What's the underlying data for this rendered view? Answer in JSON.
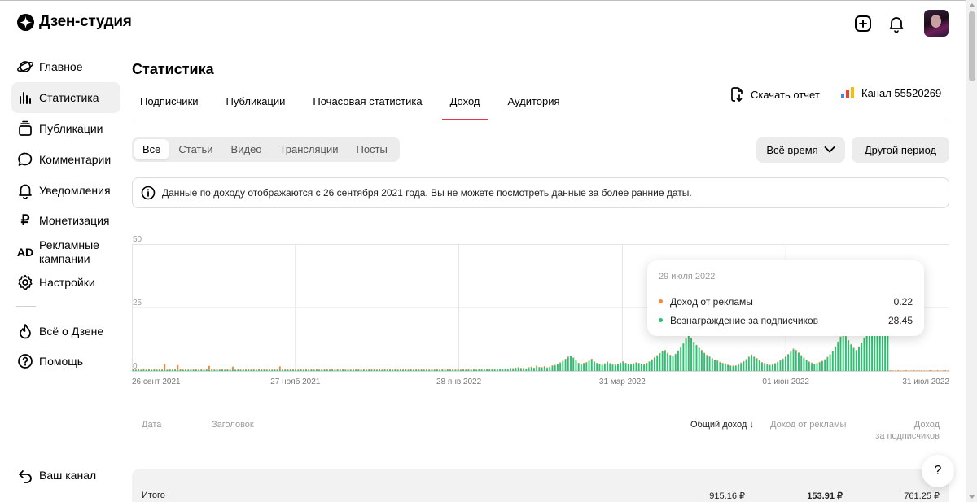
{
  "app": {
    "title": "Дзен-студия"
  },
  "header": {
    "add_icon": "plus-square-icon",
    "bell_icon": "bell-icon",
    "avatar_icon": "avatar-image"
  },
  "sidebar": {
    "items": [
      {
        "label": "Главное",
        "icon": "planet-icon"
      },
      {
        "label": "Статистика",
        "icon": "bar-chart-icon",
        "active": true
      },
      {
        "label": "Публикации",
        "icon": "stack-icon"
      },
      {
        "label": "Комментарии",
        "icon": "comment-icon"
      },
      {
        "label": "Уведомления",
        "icon": "bell-icon"
      },
      {
        "label": "Монетизация",
        "icon": "ruble-icon"
      },
      {
        "label": "Рекламные кампании",
        "icon": "ad-icon"
      },
      {
        "label": "Настройки",
        "icon": "gear-icon"
      },
      {
        "label": "Всё о Дзене",
        "icon": "fire-icon"
      },
      {
        "label": "Помощь",
        "icon": "question-icon"
      }
    ],
    "bottom": {
      "label": "Ваш канал",
      "icon": "back-arrow-icon"
    }
  },
  "main": {
    "title": "Статистика",
    "tabs": [
      "Подписчики",
      "Публикации",
      "Почасовая статистика",
      "Доход",
      "Аудитория"
    ],
    "active_tab": "Доход",
    "download_label": "Скачать отчет",
    "channel_label": "Канал 55520269",
    "content_filters": [
      "Все",
      "Статьи",
      "Видео",
      "Трансляции",
      "Посты"
    ],
    "active_filter": "Все",
    "period_selected": "Всё время",
    "other_period": "Другой период",
    "notice": "Данные по доходу отображаются с 26 сентября 2021 года. Вы не можете посмотреть данные за более ранние даты."
  },
  "tooltip": {
    "date": "29 июля 2022",
    "rows": [
      {
        "label": "Доход от рекламы",
        "value": "0.22"
      },
      {
        "label": "Вознаграждение за подписчиков",
        "value": "28.45"
      }
    ]
  },
  "table": {
    "headers": {
      "date": "Дата",
      "title": "Заголовок",
      "total": "Общий доход",
      "ads": "Доход от рекламы",
      "subs_line1": "Доход",
      "subs_line2": "за подписчиков"
    },
    "total_row": {
      "label": "Итого",
      "total": "915.16 ₽",
      "ads": "153.91 ₽",
      "subs": "761.25 ₽"
    }
  },
  "help_label": "?",
  "colors": {
    "ads": "#f28a3c",
    "subs": "#2fbf71",
    "active_tab": "#e8334a"
  },
  "chart_data": {
    "type": "bar",
    "stacked": true,
    "ylim": [
      0,
      50
    ],
    "y_ticks": [
      "0",
      "25",
      "50"
    ],
    "x_tick_labels": [
      "26 сент 2021",
      "27 нояб 2021",
      "28 янв 2022",
      "31 мар 2022",
      "01 июн 2022",
      "31 июл 2022"
    ],
    "x_start": "2021-09-26",
    "x_end": "2022-07-31",
    "grid": true,
    "series": [
      {
        "name": "Доход от рекламы",
        "color": "#f28a3c",
        "values": [
          0.4,
          0.2,
          0.3,
          0.2,
          0.5,
          0.2,
          0.3,
          0.2,
          0.3,
          0.2,
          0.2,
          0.3,
          2.1,
          0.2,
          0.3,
          0.2,
          0.4,
          1.9,
          0.3,
          0.2,
          0.3,
          0.2,
          0.2,
          0.3,
          0.2,
          0.2,
          0.3,
          0.2,
          0.2,
          1.6,
          0.2,
          0.3,
          0.2,
          0.2,
          0.3,
          0.2,
          0.2,
          0.3,
          1.2,
          0.2,
          0.3,
          0.2,
          0.2,
          0.3,
          0.2,
          0.2,
          0.3,
          0.2,
          0.2,
          0.3,
          0.2,
          0.2,
          0.3,
          0.2,
          0.2,
          0.3,
          1.3,
          0.2,
          0.3,
          0.2,
          0.2,
          0.3,
          0.2,
          0.2,
          0.3,
          0.2,
          0.2,
          0.3,
          0.2,
          0.2,
          0.3,
          0.2,
          0.2,
          0.3,
          0.2,
          0.2,
          0.3,
          0.2,
          0.2,
          0.3,
          0.2,
          0.2,
          0.3,
          0.2,
          0.2,
          0.3,
          0.2,
          0.2,
          0.3,
          0.2,
          0.2,
          0.3,
          0.2,
          0.2,
          0.3,
          0.2,
          0.2,
          0.3,
          0.2,
          0.2,
          0.3,
          0.2,
          0.2,
          0.3,
          0.2,
          0.2,
          0.3,
          0.2,
          0.2,
          0.3,
          0.2,
          0.2,
          0.3,
          0.2,
          0.2,
          0.3,
          0.2,
          0.2,
          0.3,
          0.2,
          0.2,
          0.3,
          0.2,
          0.2,
          0.3,
          0.2,
          0.2,
          0.3,
          0.2,
          0.2,
          0.3,
          0.2,
          0.2,
          0.3,
          0.2,
          0.2,
          0.3,
          0.2,
          0.2,
          0.3,
          0.2,
          0.2,
          0.3,
          0.2,
          0.2,
          0.3,
          0.2,
          0.2,
          0.3,
          0.2,
          0.2,
          0.3,
          0.2,
          0.2,
          0.3,
          0.2,
          0.2,
          0.3,
          0.2,
          0.2,
          0.3,
          0.2,
          0.2,
          0.3,
          0.2,
          0.2,
          0.3,
          0.2,
          0.2,
          0.3,
          0.2,
          0.2,
          0.3,
          0.2,
          0.2,
          0.3,
          0.2,
          0.2,
          0.3,
          0.2,
          0.2,
          0.3,
          0.2,
          0.2,
          0.3,
          0.2,
          0.2,
          0.3,
          0.2,
          0.2,
          0.3,
          0.2,
          0.2,
          0.3,
          0.2,
          0.2,
          0.3,
          0.2,
          0.2,
          0.3,
          0.2,
          0.2,
          0.3,
          0.2,
          0.2,
          0.3,
          0.2,
          0.2,
          0.3,
          0.2,
          0.2,
          0.3,
          0.2,
          0.2,
          0.3,
          0.2,
          0.2,
          0.3,
          0.2,
          0.2,
          0.3,
          0.2,
          0.2,
          0.3,
          0.2,
          0.2,
          0.3,
          0.2,
          0.2,
          0.3,
          0.2,
          0.2,
          0.3,
          0.2,
          0.2,
          0.3,
          0.2,
          0.2,
          0.3,
          0.2,
          0.2,
          0.3,
          0.2,
          0.2,
          0.3,
          0.2,
          0.2,
          0.3,
          0.2,
          0.2,
          0.3,
          0.2,
          0.2,
          0.3,
          0.2,
          0.2,
          0.3,
          0.2,
          0.2,
          0.3,
          0.2,
          0.2,
          0.3,
          0.2,
          0.2,
          0.3,
          0.2,
          0.2,
          0.3,
          0.2,
          0.2,
          0.3,
          0.2,
          0.2,
          0.3,
          0.2,
          0.2,
          0.3,
          0.2,
          0.2,
          0.3,
          0.2,
          0.2,
          0.3,
          0.2,
          0.2,
          0.3,
          0.2,
          0.2,
          0.3,
          0.2,
          0.2,
          0.3,
          0.2,
          0.2,
          0.3,
          0.2,
          0.2,
          0.3,
          0.2,
          0.2,
          0.3,
          0.2,
          0.2,
          0.3,
          0.2,
          0.2,
          0.3,
          0.2,
          0.2,
          0.3,
          0.2
        ]
      },
      {
        "name": "Вознаграждение за подписчиков",
        "color": "#2fbf71",
        "values": [
          0.5,
          0.4,
          0.5,
          0.4,
          0.5,
          0.4,
          0.5,
          0.4,
          0.5,
          0.4,
          0.5,
          0.4,
          0.5,
          0.4,
          0.5,
          0.4,
          0.5,
          0.4,
          0.5,
          0.4,
          0.5,
          0.4,
          0.5,
          0.4,
          0.5,
          0.4,
          0.5,
          0.4,
          0.5,
          0.4,
          0.5,
          0.4,
          0.5,
          0.4,
          0.5,
          0.4,
          0.5,
          0.4,
          0.5,
          0.4,
          0.5,
          0.4,
          0.5,
          0.4,
          0.5,
          0.4,
          0.5,
          0.4,
          0.5,
          0.4,
          0.5,
          0.4,
          0.5,
          0.4,
          0.5,
          0.4,
          0.5,
          0.4,
          0.5,
          0.4,
          0.5,
          0.4,
          0.5,
          0.4,
          0.5,
          0.4,
          0.5,
          0.4,
          0.5,
          0.4,
          0.5,
          0.4,
          0.5,
          0.4,
          0.5,
          0.4,
          0.5,
          0.4,
          0.5,
          0.4,
          0.5,
          0.4,
          0.5,
          0.4,
          0.5,
          0.4,
          0.5,
          0.4,
          0.5,
          0.4,
          0.5,
          0.4,
          0.5,
          0.4,
          0.5,
          0.4,
          0.5,
          0.4,
          0.5,
          0.4,
          0.5,
          0.4,
          0.5,
          0.4,
          0.5,
          0.4,
          0.5,
          0.4,
          0.5,
          0.4,
          0.5,
          0.4,
          0.5,
          0.4,
          0.5,
          0.4,
          0.5,
          0.4,
          0.5,
          0.4,
          0.5,
          0.4,
          0.5,
          0.4,
          0.5,
          0.4,
          0.5,
          0.4,
          0.5,
          0.4,
          0.5,
          0.4,
          0.6,
          0.5,
          0.6,
          0.5,
          0.6,
          0.5,
          0.6,
          0.5,
          0.7,
          0.6,
          0.7,
          0.6,
          1.0,
          0.8,
          1.1,
          1.3,
          0.9,
          1.0,
          0.8,
          1.2,
          1.5,
          1.1,
          1.8,
          1.4,
          1.3,
          1.6,
          1.2,
          1.5,
          1.9,
          2.2,
          2.6,
          3.1,
          3.8,
          4.6,
          5.4,
          5.9,
          5.1,
          4.0,
          3.0,
          2.4,
          2.9,
          3.3,
          3.9,
          4.5,
          3.6,
          3.0,
          2.6,
          2.3,
          2.8,
          3.4,
          2.9,
          2.5,
          2.2,
          2.6,
          3.1,
          3.5,
          3.0,
          2.7,
          2.4,
          2.8,
          3.2,
          2.9,
          2.6,
          2.4,
          2.9,
          3.6,
          4.4,
          5.2,
          6.0,
          6.9,
          7.7,
          8.1,
          7.0,
          6.1,
          5.7,
          6.6,
          7.8,
          9.1,
          10.8,
          12.6,
          14.0,
          12.8,
          11.2,
          10.1,
          9.0,
          8.0,
          7.0,
          6.2,
          5.5,
          4.9,
          4.3,
          3.9,
          3.4,
          3.0,
          2.7,
          2.3,
          2.0,
          1.8,
          2.0,
          2.4,
          3.0,
          3.7,
          4.5,
          5.4,
          6.3,
          5.5,
          4.8,
          4.0,
          3.3,
          2.9,
          2.5,
          2.2,
          2.5,
          2.9,
          3.4,
          4.0,
          4.7,
          5.5,
          6.4,
          7.5,
          8.6,
          8.0,
          7.1,
          6.0,
          5.0,
          4.2,
          3.5,
          3.0,
          2.6,
          2.9,
          3.3,
          3.8,
          4.4,
          5.3,
          6.4,
          7.7,
          9.4,
          11.4,
          13.4,
          15.2,
          13.6,
          12.0,
          10.3,
          9.0,
          8.1,
          9.4,
          11.0,
          13.0,
          15.4,
          18.1,
          21.0,
          24.0,
          26.4,
          28.45,
          23.0,
          19.0,
          17.0
        ]
      }
    ]
  }
}
